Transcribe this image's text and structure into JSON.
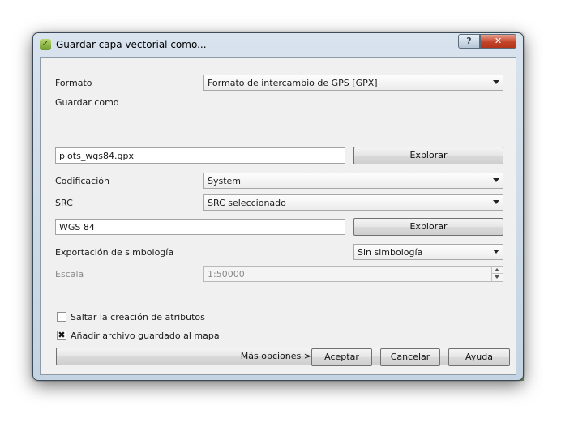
{
  "window": {
    "title": "Guardar capa vectorial como...",
    "help_label": "?",
    "close_label": "✕"
  },
  "form": {
    "format_label": "Formato",
    "format_value": "Formato de intercambio de GPS [GPX]",
    "save_as_label": "Guardar como",
    "save_as_value": "plots_wgs84.gpx",
    "browse_label": "Explorar",
    "encoding_label": "Codificación",
    "encoding_value": "System",
    "crs_label": "SRC",
    "crs_value": "SRC seleccionado",
    "crs_text": "WGS 84",
    "browse_crs_label": "Explorar",
    "symbology_label": "Exportación de simbología",
    "symbology_value": "Sin simbología",
    "scale_label": "Escala",
    "scale_value": "1:50000",
    "skip_attributes_label": "Saltar la creación de atributos",
    "skip_attributes_checked": false,
    "add_to_map_label": "Añadir archivo guardado al mapa",
    "add_to_map_checked": true,
    "more_options_label": "Más opciones >>"
  },
  "buttons": {
    "accept": "Aceptar",
    "cancel": "Cancelar",
    "help": "Ayuda"
  },
  "icons": {
    "title_icon": "qgis-save-layer-icon",
    "checkmark": "✖"
  }
}
